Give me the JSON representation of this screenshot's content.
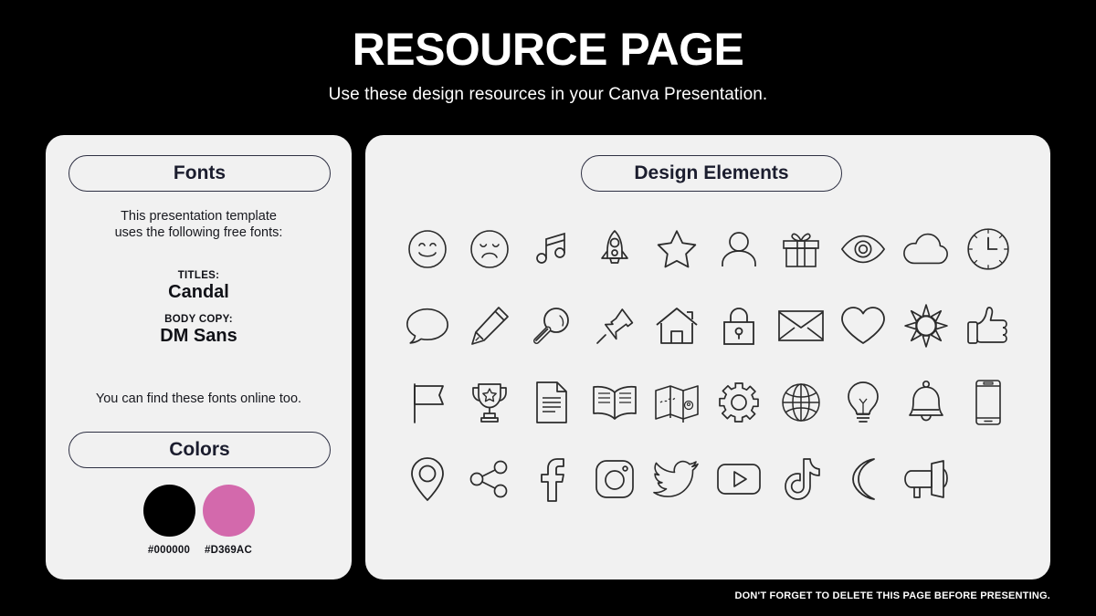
{
  "header": {
    "title": "RESOURCE PAGE",
    "subtitle": "Use these design resources in your Canva Presentation."
  },
  "left_panel": {
    "fonts_heading": "Fonts",
    "intro_line1": "This presentation template",
    "intro_line2": "uses the following free fonts:",
    "titles_label": "TITLES:",
    "titles_font": "Candal",
    "body_label": "BODY COPY:",
    "body_font": "DM Sans",
    "find_online": "You can find these fonts online too.",
    "colors_heading": "Colors",
    "swatches": [
      {
        "hex": "#000000",
        "color": "#000000"
      },
      {
        "hex": "#D369AC",
        "color": "#D369AC"
      }
    ]
  },
  "right_panel": {
    "design_heading": "Design Elements",
    "icons": [
      "happy-face-icon",
      "sad-face-icon",
      "music-note-icon",
      "rocket-icon",
      "star-icon",
      "person-icon",
      "gift-icon",
      "eye-icon",
      "cloud-icon",
      "clock-icon",
      "speech-bubble-icon",
      "pencil-icon",
      "magnifier-icon",
      "pushpin-icon",
      "house-icon",
      "lock-icon",
      "envelope-icon",
      "heart-icon",
      "sun-icon",
      "thumbs-up-icon",
      "flag-icon",
      "trophy-icon",
      "document-icon",
      "open-book-icon",
      "map-icon",
      "gear-icon",
      "globe-icon",
      "lightbulb-icon",
      "bell-icon",
      "smartphone-icon",
      "location-pin-icon",
      "share-icon",
      "facebook-icon",
      "instagram-icon",
      "twitter-icon",
      "youtube-icon",
      "tiktok-icon",
      "moon-icon",
      "megaphone-icon"
    ]
  },
  "footer": {
    "note": "DON'T FORGET TO DELETE THIS PAGE BEFORE PRESENTING."
  }
}
